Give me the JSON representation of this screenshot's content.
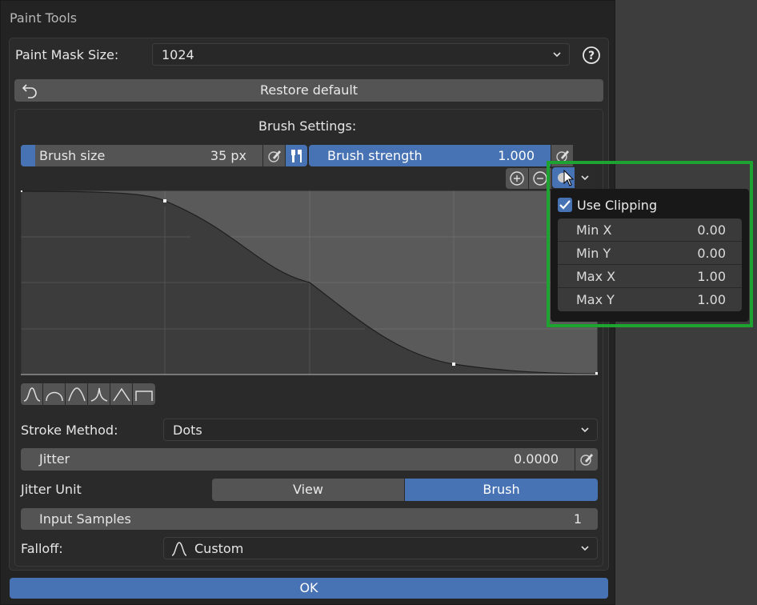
{
  "window": {
    "title": "Paint Tools"
  },
  "paint_mask": {
    "label": "Paint Mask Size:",
    "value": "1024"
  },
  "restore_label": "Restore default",
  "brush_settings": {
    "heading": "Brush Settings:",
    "size_label": "Brush size",
    "size_value": "35 px",
    "strength_label": "Brush strength",
    "strength_value": "1.000"
  },
  "clipping_popup": {
    "use_clipping_label": "Use Clipping",
    "use_clipping_checked": true,
    "rows": [
      {
        "label": "Min X",
        "value": "0.00"
      },
      {
        "label": "Min Y",
        "value": "0.00"
      },
      {
        "label": "Max X",
        "value": "1.00"
      },
      {
        "label": "Max Y",
        "value": "1.00"
      }
    ]
  },
  "stroke": {
    "label": "Stroke Method:",
    "value": "Dots"
  },
  "jitter": {
    "label": "Jitter",
    "value": "0.0000"
  },
  "jitter_unit": {
    "label": "Jitter Unit",
    "options": [
      "View",
      "Brush"
    ],
    "selected": "Brush"
  },
  "input_samples": {
    "label": "Input Samples",
    "value": "1"
  },
  "falloff": {
    "label": "Falloff:",
    "value": "Custom"
  },
  "ok_label": "OK",
  "colors": {
    "accent": "#4772b3",
    "highlight": "#1fa330",
    "field": "#545454"
  }
}
